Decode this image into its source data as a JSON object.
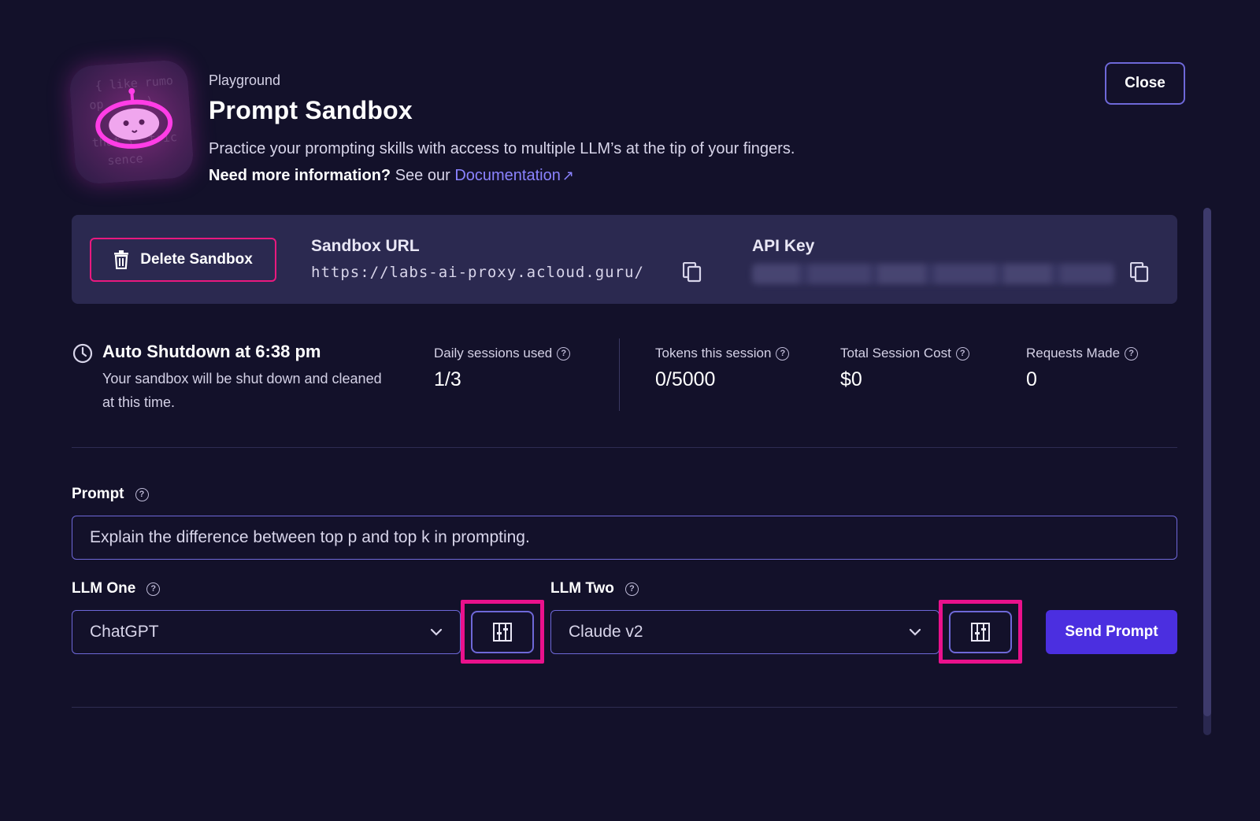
{
  "header": {
    "eyebrow": "Playground",
    "title": "Prompt Sandbox",
    "description": "Practice your prompting skills with access to multiple LLM’s at the tip of your fingers.",
    "more_info_bold": "Need more information?",
    "more_info_text": " See our ",
    "doc_link": "Documentation",
    "close_label": "Close"
  },
  "sandbox": {
    "delete_label": "Delete Sandbox",
    "url_label": "Sandbox URL",
    "url_value": "https://labs-ai-proxy.acloud.guru/",
    "api_key_label": "API Key"
  },
  "shutdown": {
    "title": "Auto Shutdown at 6:38 pm",
    "description": "Your sandbox will be shut down and cleaned at this time."
  },
  "stats": {
    "daily_sessions_label": "Daily sessions used",
    "daily_sessions_value": "1/3",
    "tokens_label": "Tokens this session",
    "tokens_value": "0/5000",
    "cost_label": "Total Session Cost",
    "cost_value": "$0",
    "requests_label": "Requests Made",
    "requests_value": "0"
  },
  "prompt": {
    "label": "Prompt",
    "value": "Explain the difference between top p and top k in prompting."
  },
  "llm_one": {
    "label": "LLM One",
    "selected": "ChatGPT"
  },
  "llm_two": {
    "label": "LLM Two",
    "selected": "Claude v2"
  },
  "send_label": "Send Prompt",
  "colors": {
    "background": "#13112a",
    "accent": "#4b2fe0",
    "link": "#8b83ff",
    "danger": "#e9197f",
    "highlight": "#ea118c"
  }
}
